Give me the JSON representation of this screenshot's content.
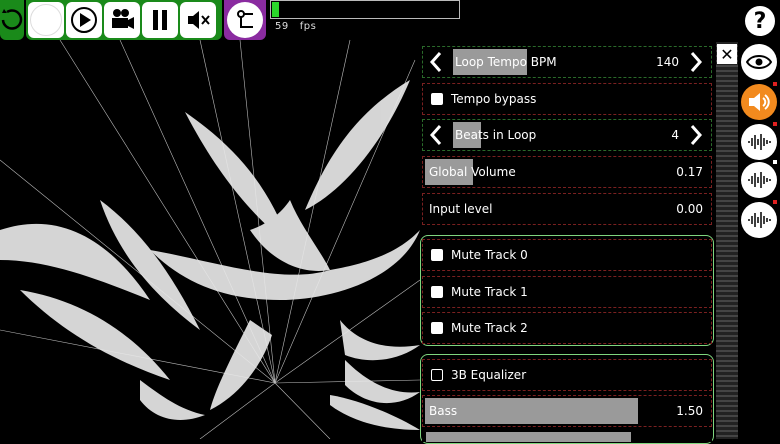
{
  "fps": {
    "value": "59",
    "unit": "fps",
    "fill_fraction": 0.035
  },
  "toolbar": {
    "buttons": [
      "reset-icon",
      "record-circle-icon",
      "play-icon",
      "video-camera-icon",
      "pause-icon",
      "mute-icon",
      "settings-slider-icon"
    ]
  },
  "panel": {
    "close_label": "✕",
    "loop_tempo": {
      "label": "Loop Tempo BPM",
      "value": "140",
      "fill_fraction": 0.32
    },
    "tempo_bypass": {
      "label": "Tempo bypass",
      "checked": true
    },
    "beats_in_loop": {
      "label": "Beats in Loop",
      "value": "4",
      "fill_fraction": 0.12
    },
    "global_volume": {
      "label": "Global Volume",
      "value": "0.17",
      "fill_fraction": 0.17
    },
    "input_level": {
      "label": "Input level",
      "value": "0.00"
    },
    "mute_tracks": [
      {
        "label": "Mute Track 0",
        "checked": true
      },
      {
        "label": "Mute Track 1",
        "checked": true
      },
      {
        "label": "Mute Track 2",
        "checked": true
      }
    ],
    "equalizer": {
      "label": "3B Equalizer",
      "checked": false
    },
    "bass": {
      "label": "Bass",
      "value": "1.50",
      "fill_fraction": 0.75
    }
  },
  "side": {
    "help": "?",
    "buttons": [
      "eye-icon",
      "speaker-icon",
      "waveform-icon",
      "waveform-icon",
      "waveform-icon"
    ]
  },
  "colors": {
    "toolbar_green": "#1a8a1a",
    "accent_orange": "#f28a1e",
    "panel_border": "#7fd67f",
    "purple": "#8a2ba0"
  }
}
